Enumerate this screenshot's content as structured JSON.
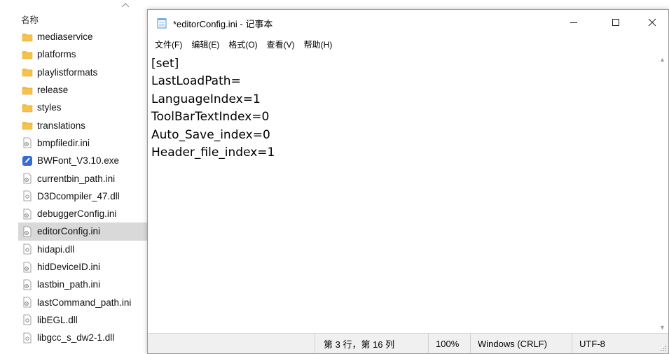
{
  "explorer": {
    "column_header": "名称",
    "files": [
      {
        "name": "mediaservice",
        "type": "folder"
      },
      {
        "name": "platforms",
        "type": "folder"
      },
      {
        "name": "playlistformats",
        "type": "folder"
      },
      {
        "name": "release",
        "type": "folder"
      },
      {
        "name": "styles",
        "type": "folder"
      },
      {
        "name": "translations",
        "type": "folder"
      },
      {
        "name": "bmpfiledir.ini",
        "type": "config"
      },
      {
        "name": "BWFont_V3.10.exe",
        "type": "exe"
      },
      {
        "name": "currentbin_path.ini",
        "type": "config"
      },
      {
        "name": "D3Dcompiler_47.dll",
        "type": "dll"
      },
      {
        "name": "debuggerConfig.ini",
        "type": "config"
      },
      {
        "name": "editorConfig.ini",
        "type": "config",
        "selected": true
      },
      {
        "name": "hidapi.dll",
        "type": "dll"
      },
      {
        "name": "hidDeviceID.ini",
        "type": "config"
      },
      {
        "name": "lastbin_path.ini",
        "type": "config"
      },
      {
        "name": "lastCommand_path.ini",
        "type": "config"
      },
      {
        "name": "libEGL.dll",
        "type": "dll"
      },
      {
        "name": "libgcc_s_dw2-1.dll",
        "type": "dll"
      }
    ]
  },
  "notepad": {
    "title": "*editorConfig.ini - 记事本",
    "menu": [
      "文件(F)",
      "编辑(E)",
      "格式(O)",
      "查看(V)",
      "帮助(H)"
    ],
    "content_lines": [
      "[set]",
      "LastLoadPath=",
      "LanguageIndex=1",
      "ToolBarTextIndex=0",
      "Auto_Save_index=0",
      "Header_file_index=1"
    ],
    "status": {
      "position": "第 3 行，第 16 列",
      "zoom": "100%",
      "line_ending": "Windows (CRLF)",
      "encoding": "UTF-8"
    }
  },
  "icons": {
    "folder_color": "#f5c24a",
    "exe_color": "#2f6fd6",
    "selection_color": "#d9d9d9"
  }
}
